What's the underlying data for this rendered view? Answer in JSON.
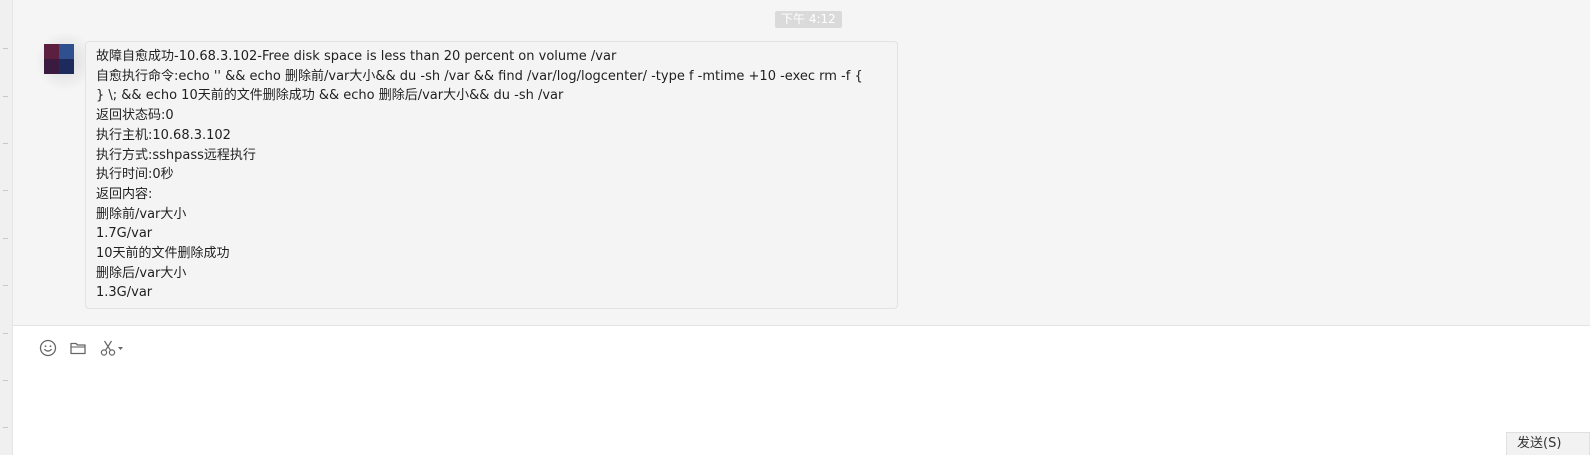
{
  "chat": {
    "timestamp": "下午 4:12",
    "message": {
      "lines": [
        "故障自愈成功-10.68.3.102-Free disk space is less than 20 percent on volume /var",
        "自愈执行命令:echo '' && echo 删除前/var大小&& du -sh /var && find /var/log/logcenter/ -type f -mtime +10 -exec rm -f {",
        "} \\; && echo 10天前的文件删除成功 && echo 删除后/var大小&& du -sh /var",
        "返回状态码:0",
        "执行主机:10.68.3.102",
        "执行方式:sshpass远程执行",
        "执行时间:0秒",
        "返回内容:",
        "删除前/var大小",
        "1.7G/var",
        "10天前的文件删除成功",
        "删除后/var大小",
        "1.3G/var"
      ]
    }
  },
  "avatar": {
    "colors": [
      "#5c1f3f",
      "#2f4f8f",
      "#3a1a3f",
      "#1c2a5c"
    ]
  },
  "toolbar": {
    "icons": [
      "emoji-icon",
      "folder-icon",
      "scissors-icon"
    ]
  },
  "composer": {
    "value": "",
    "send_label": "发送(S)"
  }
}
